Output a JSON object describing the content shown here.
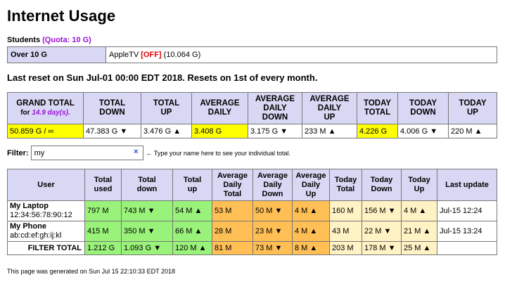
{
  "title": "Internet Usage",
  "quota": {
    "section_label": "Students",
    "quota_text": "(Quota: 10 G)",
    "row_label": "Over 10 G",
    "device_name": "AppleTV",
    "device_status": "[OFF]",
    "device_usage": "(10.064 G)"
  },
  "reset_text": "Last reset on Sun Jul-01 00:00 EDT 2018. Resets on 1st of every month.",
  "totals": {
    "headers": {
      "grand_total": "GRAND TOTAL",
      "grand_total_for": "for",
      "grand_total_days": "14.9 day(s).",
      "total_down": [
        "TOTAL",
        "DOWN"
      ],
      "total_up": [
        "TOTAL",
        "UP"
      ],
      "average_daily": [
        "AVERAGE",
        "DAILY"
      ],
      "average_daily_down": [
        "AVERAGE",
        "DAILY",
        "DOWN"
      ],
      "average_daily_up": [
        "AVERAGE",
        "DAILY",
        "UP"
      ],
      "today_total": [
        "TODAY",
        "TOTAL"
      ],
      "today_down": [
        "TODAY",
        "DOWN"
      ],
      "today_up": [
        "TODAY",
        "UP"
      ]
    },
    "values": {
      "grand_total": "50.859 G / ∞",
      "total_down": "47.383 G ▼",
      "total_up": "3.476 G ▲",
      "average_daily": "3.408 G",
      "average_daily_down": "3.175 G ▼",
      "average_daily_up": "233 M ▲",
      "today_total": "4.226 G",
      "today_down": "4.006 G ▼",
      "today_up": "220 M ▲"
    }
  },
  "filter": {
    "label": "Filter:",
    "value": "my",
    "clear_glyph": "×",
    "hint": "← Type your name here to see your individual total."
  },
  "users": {
    "headers": {
      "user": "User",
      "total_used": [
        "Total",
        "used"
      ],
      "total_down": [
        "Total",
        "down"
      ],
      "total_up": [
        "Total",
        "up"
      ],
      "avg_daily_total": [
        "Average",
        "Daily",
        "Total"
      ],
      "avg_daily_down": [
        "Average",
        "Daily",
        "Down"
      ],
      "avg_daily_up": [
        "Average",
        "Daily",
        "Up"
      ],
      "today_total": [
        "Today",
        "Total"
      ],
      "today_down": [
        "Today",
        "Down"
      ],
      "today_up": [
        "Today",
        "Up"
      ],
      "last_update": "Last update"
    },
    "rows": [
      {
        "name": "My Laptop",
        "mac": "12:34:56:78:90:12",
        "total_used": "797 M",
        "total_down": "743 M ▼",
        "total_up": "54 M ▲",
        "avg_daily_total": "53 M",
        "avg_daily_down": "50 M ▼",
        "avg_daily_up": "4 M ▲",
        "today_total": "160 M",
        "today_down": "156 M ▼",
        "today_up": "4 M ▲",
        "last_update": "Jul-15 12:24"
      },
      {
        "name": "My Phone",
        "mac": "ab:cd:ef:gh:ij:kl",
        "total_used": "415 M",
        "total_down": "350 M ▼",
        "total_up": "66 M ▲",
        "avg_daily_total": "28 M",
        "avg_daily_down": "23 M ▼",
        "avg_daily_up": "4 M ▲",
        "today_total": "43 M",
        "today_down": "22 M ▼",
        "today_up": "21 M ▲",
        "last_update": "Jul-15 13:24"
      }
    ],
    "filter_total": {
      "label": "FILTER TOTAL",
      "total_used": "1.212 G",
      "total_down": "1.093 G ▼",
      "total_up": "120 M ▲",
      "avg_daily_total": "81 M",
      "avg_daily_down": "73 M ▼",
      "avg_daily_up": "8 M ▲",
      "today_total": "203 M",
      "today_down": "178 M ▼",
      "today_up": "25 M ▲",
      "last_update": ""
    }
  },
  "footer": "This page was generated on Sun Jul 15 22:10:33 EDT 2018",
  "colors": {
    "header_bg": "#d8d8f4",
    "quota_purple": "#9a10d6",
    "off_red": "#e00000",
    "highlight_yellow": "#ffff00",
    "totals_green": "#99f27a",
    "averages_orange": "#ffbf55",
    "today_cream": "#fff2c4"
  }
}
